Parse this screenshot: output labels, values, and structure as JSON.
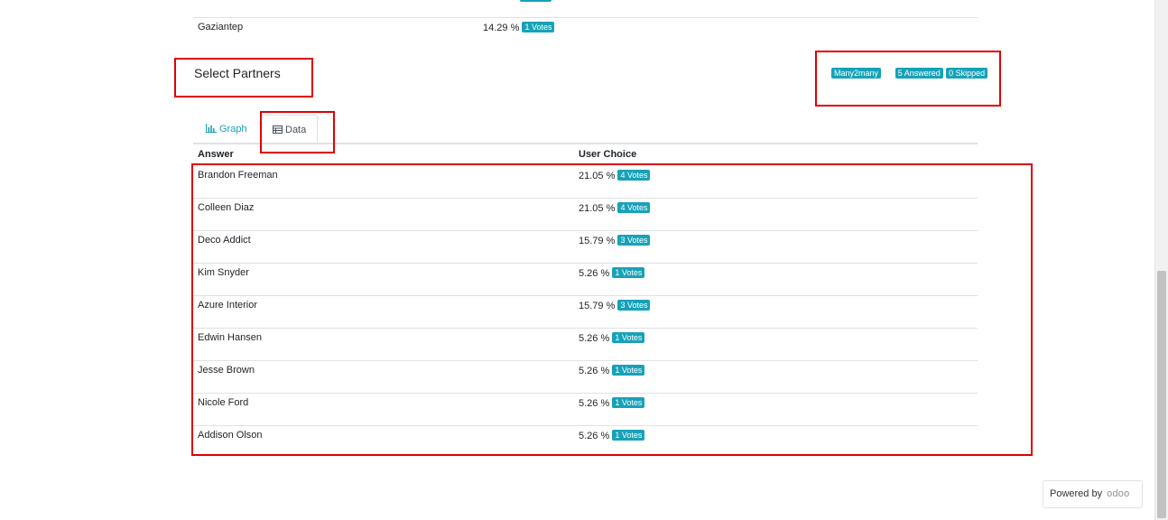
{
  "previous_question": {
    "row_label": "Gaziantep",
    "percent": "14.29 %",
    "votes": "1 Votes"
  },
  "question": {
    "title": "Select Partners",
    "type_badge": "Many2many",
    "answered_badge": "5 Answered",
    "skipped_badge": "0 Skipped"
  },
  "tabs": {
    "graph_label": "Graph",
    "data_label": "Data",
    "active": "Data"
  },
  "table": {
    "headers": {
      "answer": "Answer",
      "user_choice": "User Choice"
    },
    "rows": [
      {
        "answer": "Brandon Freeman",
        "percent": "21.05 %",
        "votes": "4 Votes"
      },
      {
        "answer": "Colleen Diaz",
        "percent": "21.05 %",
        "votes": "4 Votes"
      },
      {
        "answer": "Deco Addict",
        "percent": "15.79 %",
        "votes": "3 Votes"
      },
      {
        "answer": "Kim Snyder",
        "percent": "5.26 %",
        "votes": "1 Votes"
      },
      {
        "answer": "Azure Interior",
        "percent": "15.79 %",
        "votes": "3 Votes"
      },
      {
        "answer": "Edwin Hansen",
        "percent": "5.26 %",
        "votes": "1 Votes"
      },
      {
        "answer": "Jesse Brown",
        "percent": "5.26 %",
        "votes": "1 Votes"
      },
      {
        "answer": "Nicole Ford",
        "percent": "5.26 %",
        "votes": "1 Votes"
      },
      {
        "answer": "Addison Olson",
        "percent": "5.26 %",
        "votes": "1 Votes"
      }
    ]
  },
  "footer": {
    "powered_by": "Powered by",
    "logo_text": "odoo"
  },
  "colors": {
    "badge": "#17a2b8",
    "highlight_box": "#e00000",
    "tab_link": "#17a2b8"
  },
  "icons": {
    "graph_tab": "bar-chart-icon",
    "data_tab": "table-icon"
  }
}
